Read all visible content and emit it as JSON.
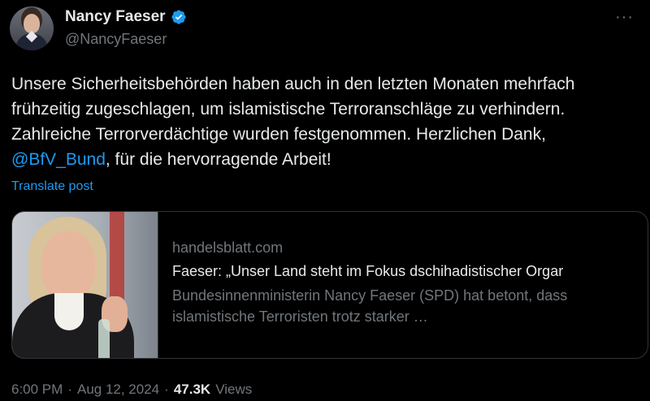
{
  "author": {
    "display_name": "Nancy Faeser",
    "handle": "@NancyFaeser",
    "verified_icon": "verified-badge-icon"
  },
  "post": {
    "text_before": "Unsere Sicherheitsbehörden haben auch in den letzten Monaten mehrfach frühzeitig zugeschlagen, um islamistische Terroranschläge zu verhindern. Zahlreiche Terrorverdächtige wurden festgenommen. Herzlichen Dank, ",
    "mention": "@BfV_Bund",
    "text_after": ", für die hervorragende Arbeit!",
    "translate_label": "Translate post"
  },
  "link_card": {
    "domain": "handelsblatt.com",
    "title": "Faeser: „Unser Land steht im Fokus dschihadistischer Orgar",
    "description": "Bundesinnenministerin Nancy Faeser (SPD) hat betont, dass islamistische Terroristen trotz starker …"
  },
  "meta": {
    "time": "6:00 PM",
    "sep1": "·",
    "date": "Aug 12, 2024",
    "sep2": "·",
    "views_count": "47.3K",
    "views_label": "Views"
  },
  "more_label": "···",
  "colors": {
    "background": "#000000",
    "text": "#e7e9ea",
    "secondary": "#71767b",
    "accent": "#1d9bf0"
  }
}
